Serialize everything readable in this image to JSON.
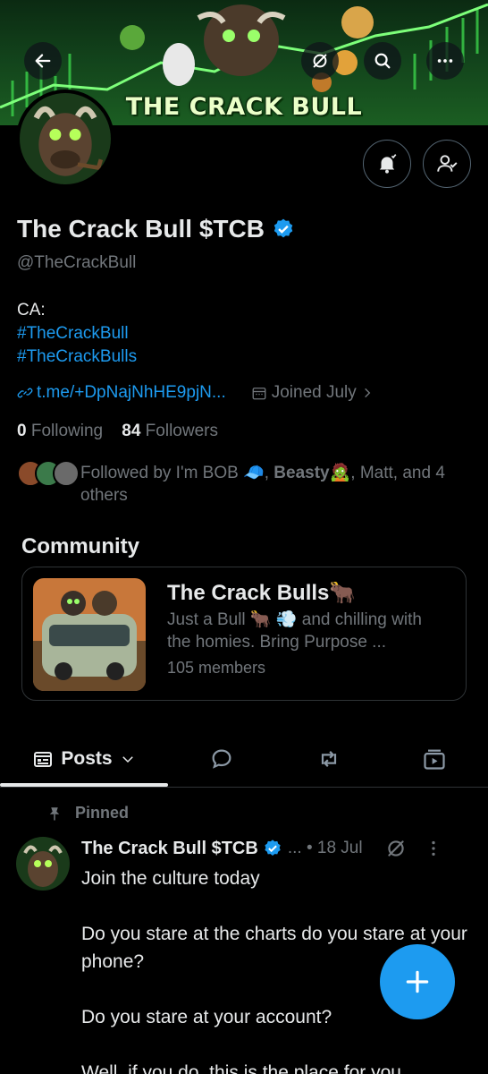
{
  "banner": {
    "title": "THE CRACK BULL"
  },
  "profile": {
    "name": "The Crack Bull $TCB",
    "handle": "@TheCrackBull",
    "bio": {
      "line1": "CA:",
      "tag1": "#TheCrackBull",
      "tag2": "#TheCrackBulls"
    },
    "link": "t.me/+DpNajNhHE9pjN...",
    "joined": "Joined July",
    "following_count": "0",
    "following_label": "Following",
    "followers_count": "84",
    "followers_label": "Followers",
    "followed_by_prefix": "Followed by I'm BOB 🧢, ",
    "followed_by_bold": "Beasty",
    "followed_by_suffix": "🧟, Matt, and 4 others"
  },
  "community": {
    "heading": "Community",
    "title": "The Crack Bulls🐂",
    "description": "Just a Bull 🐂 💨     and chilling with the homies. Bring Purpose ...",
    "members": "105 members"
  },
  "tabs": {
    "posts_label": "Posts"
  },
  "post": {
    "pinned_label": "Pinned",
    "author": "The Crack Bull $TCB",
    "meta": "... • 18 Jul",
    "p1": "Join the culture today",
    "p2": "Do you stare at the charts do you stare at your phone?",
    "p3": "Do you stare at your account?",
    "p4": "Well, if you do, this is the place for you"
  },
  "colors": {
    "accent": "#1d9bf0",
    "muted": "#71767b",
    "border": "#2f3336",
    "text": "#e7e9ea"
  }
}
